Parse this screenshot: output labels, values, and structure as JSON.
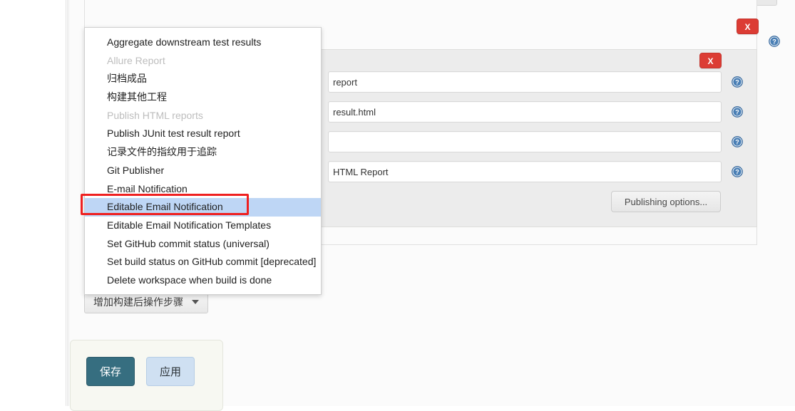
{
  "panels": {
    "delete_label": "X"
  },
  "form": {
    "fields": [
      {
        "name": "report-dir",
        "value": "report",
        "placeholder": ""
      },
      {
        "name": "index-page",
        "value": "result.html",
        "placeholder": ""
      },
      {
        "name": "index-title",
        "value": "",
        "placeholder": ""
      },
      {
        "name": "report-title",
        "value": "HTML Report",
        "placeholder": ""
      }
    ],
    "publishing_options_label": "Publishing options...",
    "help_icon": "help-icon"
  },
  "add_step_button": {
    "label": "增加构建后操作步骤",
    "caret_icon": "chevron-down-icon"
  },
  "dropdown": {
    "items": [
      {
        "label": "Aggregate downstream test results",
        "disabled": false,
        "selected": false
      },
      {
        "label": "Allure Report",
        "disabled": true,
        "selected": false
      },
      {
        "label": "归档成品",
        "disabled": false,
        "selected": false
      },
      {
        "label": "构建其他工程",
        "disabled": false,
        "selected": false
      },
      {
        "label": "Publish HTML reports",
        "disabled": true,
        "selected": false
      },
      {
        "label": "Publish JUnit test result report",
        "disabled": false,
        "selected": false
      },
      {
        "label": "记录文件的指纹用于追踪",
        "disabled": false,
        "selected": false
      },
      {
        "label": "Git Publisher",
        "disabled": false,
        "selected": false
      },
      {
        "label": "E-mail Notification",
        "disabled": false,
        "selected": false
      },
      {
        "label": "Editable Email Notification",
        "disabled": false,
        "selected": true
      },
      {
        "label": "Editable Email Notification Templates",
        "disabled": false,
        "selected": false
      },
      {
        "label": "Set GitHub commit status (universal)",
        "disabled": false,
        "selected": false
      },
      {
        "label": "Set build status on GitHub commit [deprecated]",
        "disabled": false,
        "selected": false
      },
      {
        "label": "Delete workspace when build is done",
        "disabled": false,
        "selected": false
      }
    ]
  },
  "save_bar": {
    "save_label": "保存",
    "apply_label": "应用"
  },
  "colors": {
    "highlight": "#bed6f5",
    "annotation": "#ef2020",
    "delete": "#dc3c34",
    "save": "#366e80",
    "apply": "#cfe0f2"
  }
}
